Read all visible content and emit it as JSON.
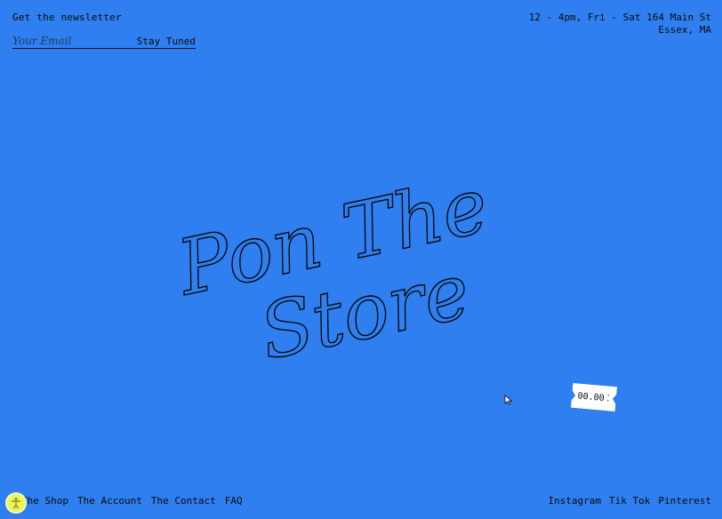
{
  "newsletter": {
    "heading": "Get the newsletter",
    "email_placeholder": "Your Email",
    "submit_label": "Stay Tuned"
  },
  "store_info": {
    "hours": "12 - 4pm, Fri - Sat 164 Main St",
    "location": "Essex, MA"
  },
  "hero": {
    "line1": "Pon The",
    "line2": "Store"
  },
  "price_tag": {
    "label": "00.00"
  },
  "footer_nav": {
    "items": [
      "The Shop",
      "The Account",
      "The Contact",
      "FAQ"
    ]
  },
  "social_nav": {
    "items": [
      "Instagram",
      "Tik Tok",
      "Pinterest"
    ]
  },
  "colors": {
    "background": "#2f7ff0",
    "text": "#0a0a0a",
    "accessibility_button": "#e9f55a"
  },
  "icons": {
    "cursor": "cursor-arrow-icon",
    "accessibility": "accessibility-person-icon"
  }
}
